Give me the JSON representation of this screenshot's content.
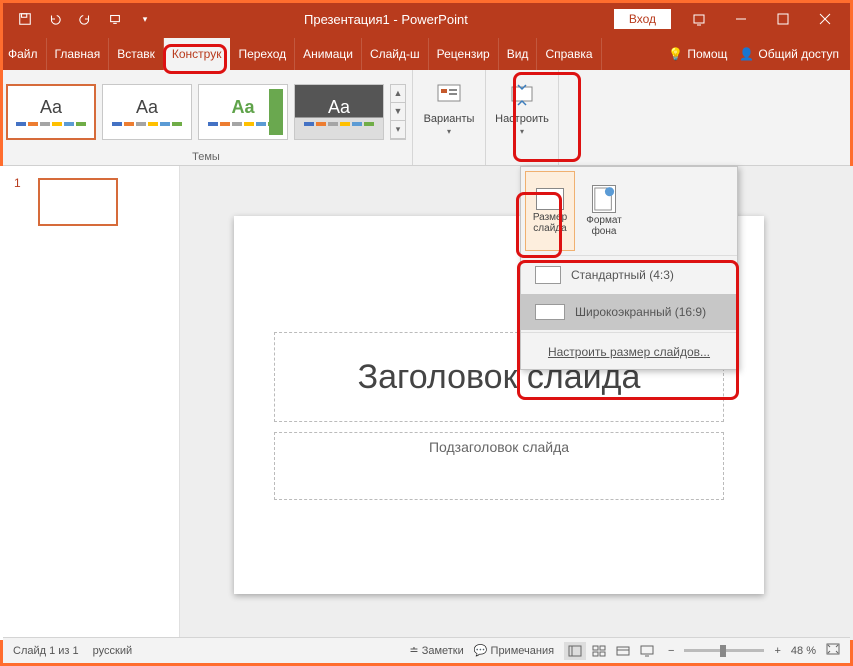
{
  "title": "Презентация1 - PowerPoint",
  "login": "Вход",
  "tabs": {
    "file": "Файл",
    "home": "Главная",
    "insert": "Вставк",
    "design": "Конструк",
    "transitions": "Переход",
    "animations": "Анимаци",
    "slideshow": "Слайд-ш",
    "review": "Рецензир",
    "view": "Вид",
    "help": "Справка"
  },
  "rightbar": {
    "assist": "Помощ",
    "share": "Общий доступ"
  },
  "ribbon": {
    "themes_label": "Темы",
    "variants": "Варианты",
    "setup": "Настроить"
  },
  "themes": {
    "aa": "Aa"
  },
  "dropdown": {
    "size": "Размер слайда",
    "format": "Формат фона",
    "standard": "Стандартный (4:3)",
    "wide": "Широкоэкранный (16:9)",
    "custom": "Настроить размер слайдов..."
  },
  "slide": {
    "title": "Заголовок слайда",
    "subtitle": "Подзаголовок слайда",
    "num": "1"
  },
  "status": {
    "slide": "Слайд 1 из 1",
    "lang": "русский",
    "notes": "Заметки",
    "comments": "Примечания",
    "zoom": "48 %",
    "plus": "+",
    "minus": "−"
  }
}
